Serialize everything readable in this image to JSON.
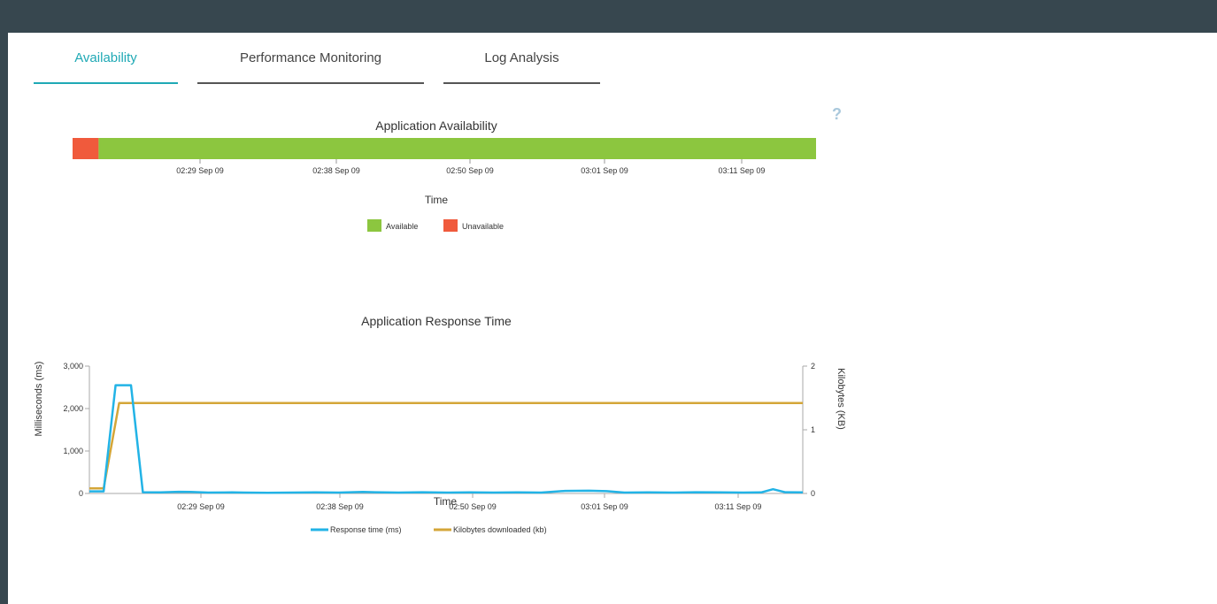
{
  "tabs": [
    {
      "label": "Availability",
      "active": true
    },
    {
      "label": "Performance Monitoring",
      "active": false
    },
    {
      "label": "Log Analysis",
      "active": false
    }
  ],
  "help_label": "?",
  "colors": {
    "header": "#37474f",
    "accent": "#1fa9b5",
    "available": "#8cc63f",
    "unavailable": "#f05a3c",
    "response_line": "#22b3e6",
    "kb_line": "#d4a638"
  },
  "chart_data": [
    {
      "type": "timeline",
      "title": "Application Availability",
      "xlabel": "Time",
      "x_ticks": [
        "02:29 Sep 09",
        "02:38 Sep 09",
        "02:50 Sep 09",
        "03:01 Sep 09",
        "03:11 Sep 09"
      ],
      "x_range_minutes": [
        0,
        60
      ],
      "segments": [
        {
          "status": "Unavailable",
          "start": 0,
          "end": 2.1
        },
        {
          "status": "Available",
          "start": 2.1,
          "end": 60
        }
      ],
      "legend": [
        "Available",
        "Unavailable"
      ]
    },
    {
      "type": "line",
      "title": "Application Response Time",
      "xlabel": "Time",
      "ylabel": "Milliseconds (ms)",
      "y2label": "Kilobytes (KB)",
      "x_ticks": [
        "02:29 Sep 09",
        "02:38 Sep 09",
        "02:50 Sep 09",
        "03:01 Sep 09",
        "03:11 Sep 09"
      ],
      "y_ticks": [
        "0",
        "1,000",
        "2,000",
        "3,000"
      ],
      "y2_ticks": [
        "0",
        "1",
        "2"
      ],
      "ylim": [
        0,
        3000
      ],
      "y2lim": [
        0,
        2
      ],
      "series": [
        {
          "name": "Response time (ms)",
          "axis": "left",
          "points": [
            [
              0,
              50
            ],
            [
              1.2,
              50
            ],
            [
              2.2,
              2550
            ],
            [
              3.5,
              2550
            ],
            [
              4.5,
              30
            ],
            [
              6,
              25
            ],
            [
              7.5,
              40
            ],
            [
              8.5,
              35
            ],
            [
              10,
              20
            ],
            [
              12,
              25
            ],
            [
              13,
              20
            ],
            [
              15,
              15
            ],
            [
              17,
              20
            ],
            [
              19,
              25
            ],
            [
              21,
              20
            ],
            [
              23,
              35
            ],
            [
              24,
              30
            ],
            [
              26,
              20
            ],
            [
              28,
              30
            ],
            [
              30,
              20
            ],
            [
              32,
              25
            ],
            [
              34,
              20
            ],
            [
              36,
              25
            ],
            [
              38,
              20
            ],
            [
              40,
              60
            ],
            [
              42,
              65
            ],
            [
              43.5,
              55
            ],
            [
              45,
              20
            ],
            [
              47,
              25
            ],
            [
              49,
              20
            ],
            [
              51,
              30
            ],
            [
              53,
              25
            ],
            [
              55,
              20
            ],
            [
              56.5,
              25
            ],
            [
              57.5,
              100
            ],
            [
              58.5,
              30
            ],
            [
              60,
              25
            ]
          ]
        },
        {
          "name": "Kilobytes downloaded (kb)",
          "axis": "right",
          "points": [
            [
              0,
              0.08
            ],
            [
              1.2,
              0.08
            ],
            [
              2.5,
              1.42
            ],
            [
              60,
              1.42
            ]
          ]
        }
      ]
    }
  ]
}
